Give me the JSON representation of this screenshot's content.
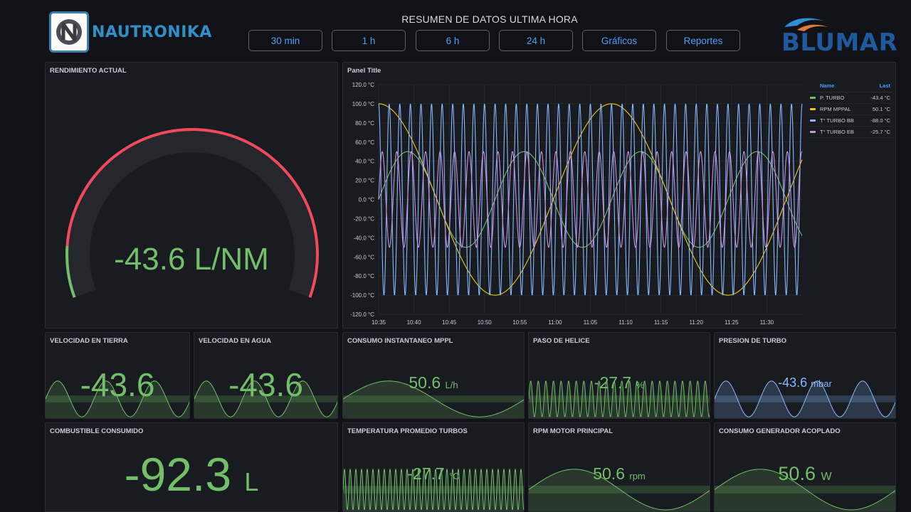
{
  "header": {
    "brand_left": "NAUTRONIKA",
    "title": "RESUMEN DE DATOS ULTIMA HORA",
    "buttons": [
      "30 min",
      "1 h",
      "6 h",
      "24 h",
      "Gráficos",
      "Reportes"
    ],
    "brand_right": "BLUMAR"
  },
  "gauge": {
    "title": "RENDIMIENTO ACTUAL",
    "value": "-43.6 L/NM",
    "colors": {
      "value": "#73bf69",
      "arc_green": "#73bf69",
      "arc_red": "#f2495c"
    }
  },
  "chart_panel": {
    "title": "Panel Title",
    "legend_header": {
      "name": "Name",
      "last": "Last"
    },
    "legend": [
      {
        "name": "P. TURBO",
        "last": "-43.4 °C",
        "color": "#73bf69"
      },
      {
        "name": "RPM MPPAL",
        "last": "50.1 °C",
        "color": "#f2cc0c"
      },
      {
        "name": "T° TURBO BB",
        "last": "-88.0 °C",
        "color": "#8ab8ff"
      },
      {
        "name": "T° TURBO EB",
        "last": "-25.7 °C",
        "color": "#ca95e5"
      }
    ]
  },
  "chart_data": {
    "type": "line",
    "title": "Panel Title",
    "xlabel": "",
    "ylabel": "",
    "x_ticks": [
      "10:35",
      "10:40",
      "10:45",
      "10:50",
      "10:55",
      "11:00",
      "11:05",
      "11:10",
      "11:15",
      "11:20",
      "11:25",
      "11:30"
    ],
    "y_ticks": [
      "120.0 °C",
      "100.0 °C",
      "80.0 °C",
      "60.0 °C",
      "40.0 °C",
      "20.0 °C",
      "0.0 °C",
      "-20.0 °C",
      "-40.0 °C",
      "-60.0 °C",
      "-80.0 °C",
      "-100.0 °C",
      "-120.0 °C"
    ],
    "ylim": [
      -120,
      120
    ],
    "x_range_minutes": [
      0,
      60
    ],
    "grid": true,
    "legend_position": "right",
    "series": [
      {
        "name": "P. TURBO",
        "amplitude": 50,
        "period_minutes": 16.5,
        "phase_deg": 0,
        "color": "#73bf69"
      },
      {
        "name": "RPM MPPAL",
        "amplitude": 100,
        "period_minutes": 33,
        "phase_deg": 90,
        "color": "#f2cc0c"
      },
      {
        "name": "T° TURBO BB",
        "amplitude": 100,
        "period_minutes": 1.5,
        "phase_deg": 90,
        "color": "#8ab8ff"
      },
      {
        "name": "T° TURBO EB",
        "amplitude": 50,
        "period_minutes": 2.05,
        "phase_deg": 0,
        "color": "#ca95e5"
      }
    ]
  },
  "stats": [
    {
      "title": "VELOCIDAD EN TIERRA",
      "value": "-43.6",
      "unit": "",
      "spark_color": "#73bf69",
      "value_color": "#73bf69"
    },
    {
      "title": "VELOCIDAD EN AGUA",
      "value": "-43.6",
      "unit": "",
      "spark_color": "#73bf69",
      "value_color": "#73bf69"
    },
    {
      "title": "CONSUMO INSTANTANEO MPPL",
      "value": "50.6",
      "unit": "L/h",
      "spark_color": "#73bf69",
      "value_color": "#73bf69"
    },
    {
      "title": "PASO DE HELICE",
      "value": "-27.7",
      "unit": "%",
      "spark_color": "#73bf69",
      "value_color": "#73bf69"
    },
    {
      "title": "PRESION DE TURBO",
      "value": "-43.6",
      "unit": "mbar",
      "spark_color": "#8ab8ff",
      "value_color": "#8ab8ff"
    },
    {
      "title": "COMBUSTIBLE CONSUMIDO",
      "value": "-92.3",
      "unit": "L",
      "spark_color": "",
      "value_color": "#73bf69"
    },
    {
      "title": "TEMPERATURA PROMEDIO TURBOS",
      "value": "-27.7",
      "unit": "°C",
      "spark_color": "#73bf69",
      "value_color": "#73bf69"
    },
    {
      "title": "RPM MOTOR PRINCIPAL",
      "value": "50.6",
      "unit": "rpm",
      "spark_color": "#73bf69",
      "value_color": "#73bf69"
    },
    {
      "title": "CONSUMO GENERADOR ACOPLADO",
      "value": "50.6",
      "unit": "W",
      "spark_color": "#73bf69",
      "value_color": "#73bf69"
    }
  ]
}
